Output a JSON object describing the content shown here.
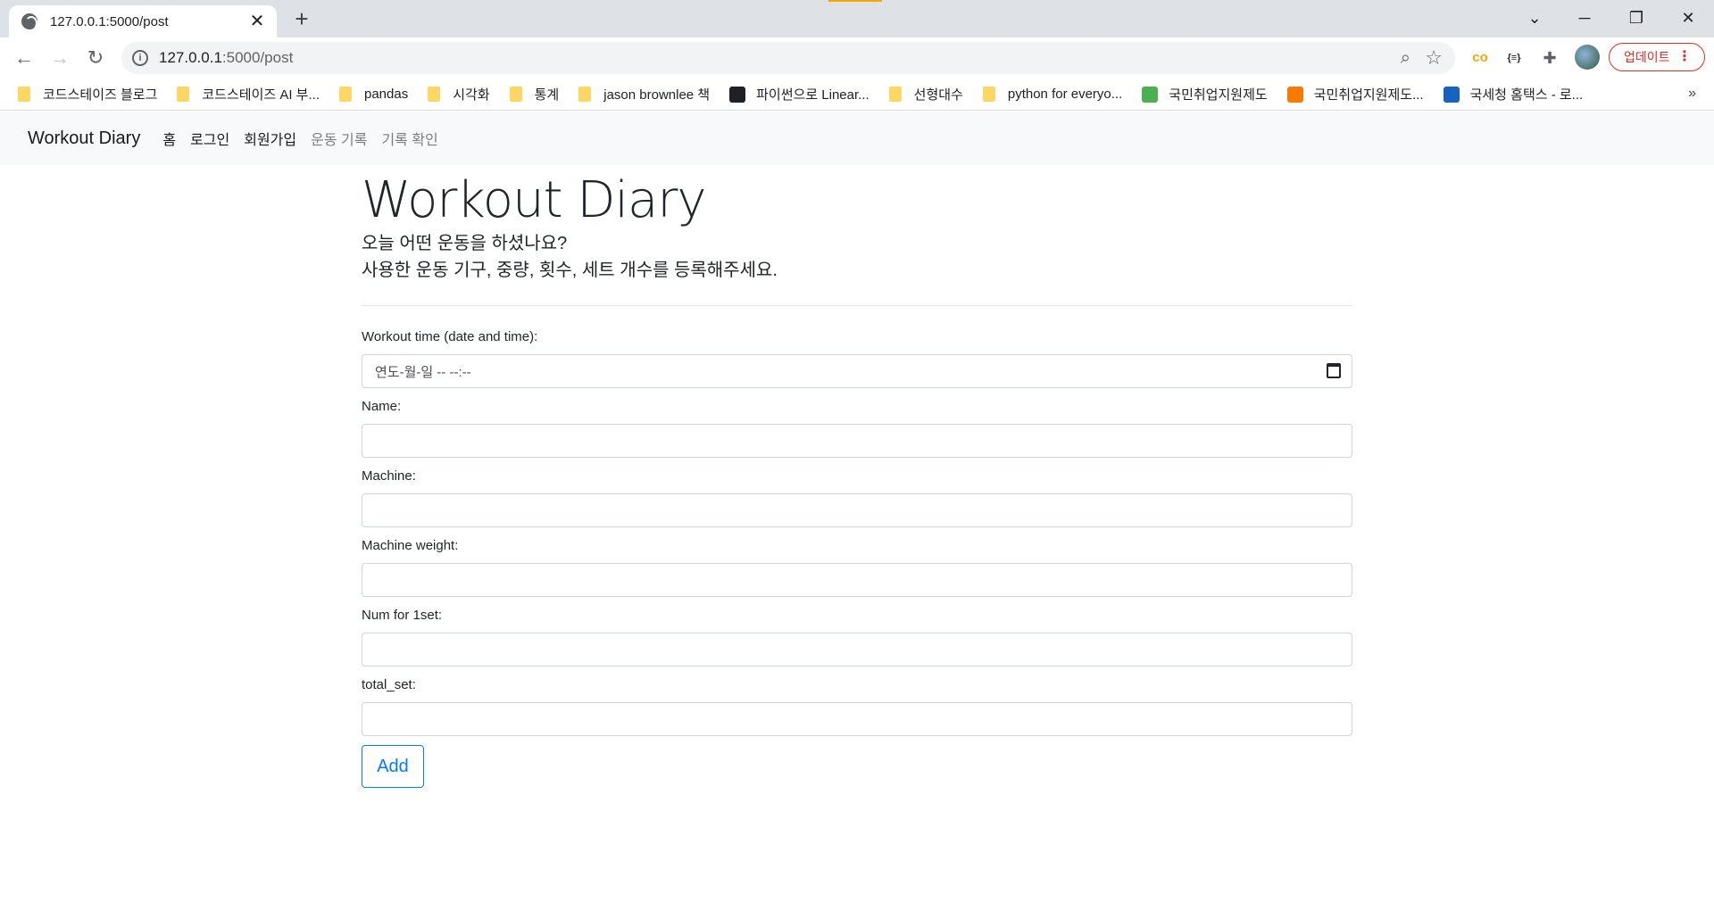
{
  "browser": {
    "tab_title": "127.0.0.1:5000/post",
    "tab_close": "✕",
    "new_tab": "+",
    "url_host": "127.0.0.1",
    "url_path": ":5000/post",
    "update_label": "업데이트",
    "bookmarks": [
      {
        "label": "코드스테이즈 블로그",
        "icon": "folder-icon"
      },
      {
        "label": "코드스테이즈 AI 부...",
        "icon": "folder-icon"
      },
      {
        "label": "pandas",
        "icon": "folder-icon"
      },
      {
        "label": "시각화",
        "icon": "folder-icon"
      },
      {
        "label": "통계",
        "icon": "folder-icon"
      },
      {
        "label": "jason brownlee 책",
        "icon": "folder-icon"
      },
      {
        "label": "파이썬으로 Linear...",
        "icon": "site-icon"
      },
      {
        "label": "선형대수",
        "icon": "folder-icon"
      },
      {
        "label": "python for everyo...",
        "icon": "folder-icon"
      },
      {
        "label": "국민취업지원제도",
        "icon": "site-icon"
      },
      {
        "label": "국민취업지원제도...",
        "icon": "site-icon"
      },
      {
        "label": "국세청 홈택스 - 로...",
        "icon": "site-icon"
      }
    ],
    "bookmarks_more": "»",
    "accent_color": "#1a73e8"
  },
  "navbar": {
    "brand": "Workout Diary",
    "links": [
      {
        "label": "홈",
        "state": "active"
      },
      {
        "label": "로그인",
        "state": "active"
      },
      {
        "label": "회원가입",
        "state": "active"
      },
      {
        "label": "운동 기록",
        "state": "muted"
      },
      {
        "label": "기록 확인",
        "state": "muted"
      }
    ]
  },
  "main": {
    "title": "Workout Diary",
    "lead_line1": "오늘 어떤 운동을 하셨나요?",
    "lead_line2": "사용한 운동 기구, 중량, 횟수, 세트 개수를 등록해주세요.",
    "form": {
      "fields": [
        {
          "label": "Workout time (date and time):",
          "value": "연도-월-일 -- --:--",
          "type": "datetime"
        },
        {
          "label": "Name:",
          "value": "",
          "type": "text"
        },
        {
          "label": "Machine:",
          "value": "",
          "type": "text"
        },
        {
          "label": "Machine weight:",
          "value": "",
          "type": "text"
        },
        {
          "label": "Num for 1set:",
          "value": "",
          "type": "text"
        },
        {
          "label": "total_set:",
          "value": "",
          "type": "text"
        }
      ],
      "submit_label": "Add",
      "submit_color": "#007bff"
    }
  }
}
